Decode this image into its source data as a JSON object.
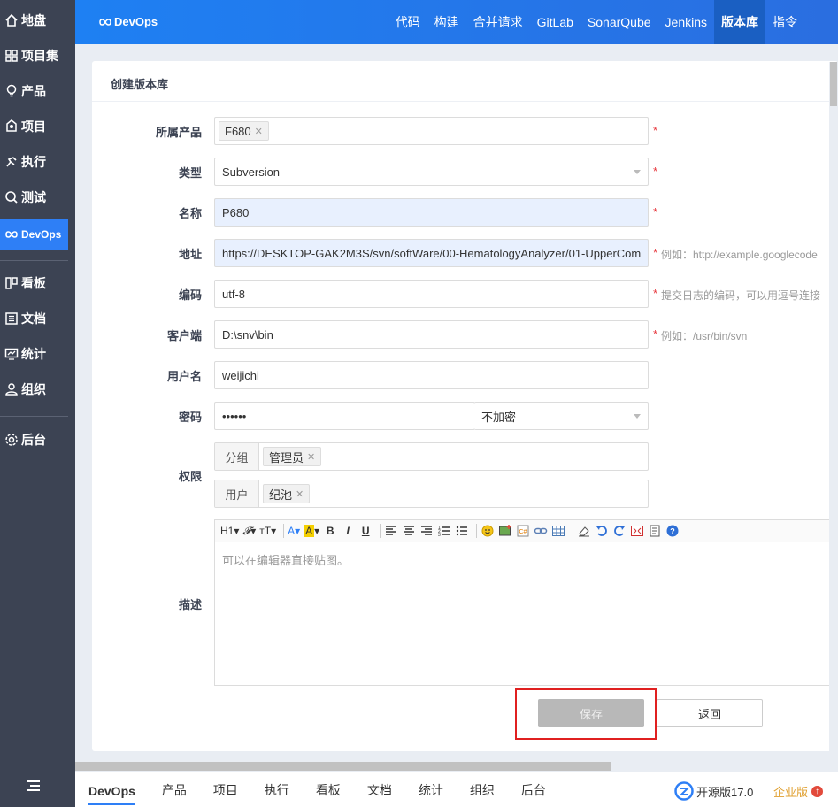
{
  "sidebar": {
    "items": [
      {
        "label": "地盘",
        "icon": "home-icon"
      },
      {
        "label": "项目集",
        "icon": "grid-icon"
      },
      {
        "label": "产品",
        "icon": "bulb-icon"
      },
      {
        "label": "项目",
        "icon": "project-icon"
      },
      {
        "label": "执行",
        "icon": "run-icon"
      },
      {
        "label": "测试",
        "icon": "search-icon"
      },
      {
        "label": "DevOps",
        "icon": "infinity-icon"
      },
      {
        "label": "看板",
        "icon": "kanban-icon"
      },
      {
        "label": "文档",
        "icon": "doc-icon"
      },
      {
        "label": "统计",
        "icon": "chart-icon"
      },
      {
        "label": "组织",
        "icon": "user-icon"
      },
      {
        "label": "后台",
        "icon": "gear-icon"
      }
    ]
  },
  "header": {
    "logo": "DevOps",
    "nav": [
      "代码",
      "构建",
      "合并请求",
      "GitLab",
      "SonarQube",
      "Jenkins",
      "版本库",
      "指令"
    ],
    "active": "版本库"
  },
  "form": {
    "title": "创建版本库",
    "product_label": "所属产品",
    "product_tag": "F680",
    "type_label": "类型",
    "type_value": "Subversion",
    "name_label": "名称",
    "name_value": "P680",
    "url_label": "地址",
    "url_value": "https://DESKTOP-GAK2M3S/svn/softWare/00-HematologyAnalyzer/01-UpperCom",
    "url_hint": "例如：http://example.googlecode",
    "encoding_label": "编码",
    "encoding_value": "utf-8",
    "encoding_hint": "提交日志的编码，可以用逗号连接",
    "client_label": "客户端",
    "client_value": "D:\\snv\\bin",
    "client_hint": "例如：/usr/bin/svn",
    "user_label": "用户名",
    "user_value": "weijichi",
    "password_label": "密码",
    "password_value": "••••••",
    "encrypt_value": "不加密",
    "acl_label": "权限",
    "acl_group_label": "分组",
    "acl_group_tag": "管理员",
    "acl_user_label": "用户",
    "acl_user_tag": "纪池",
    "desc_label": "描述",
    "desc_placeholder": "可以在编辑器直接贴图。",
    "required_mark": "*",
    "save_label": "保存",
    "back_label": "返回"
  },
  "editor_toolbar": {
    "heading": "H1",
    "font": "𝓕",
    "size": "тT",
    "bold": "B",
    "italic": "I",
    "underline": "U"
  },
  "footer": {
    "nav": [
      "DevOps",
      "产品",
      "项目",
      "执行",
      "看板",
      "文档",
      "统计",
      "组织",
      "后台"
    ],
    "active": "DevOps",
    "version": "开源版17.0",
    "enterprise": "企业版"
  },
  "colors": {
    "sidebar": "#3c4353",
    "accent": "#2e7ff6",
    "required": "#e7363c"
  }
}
